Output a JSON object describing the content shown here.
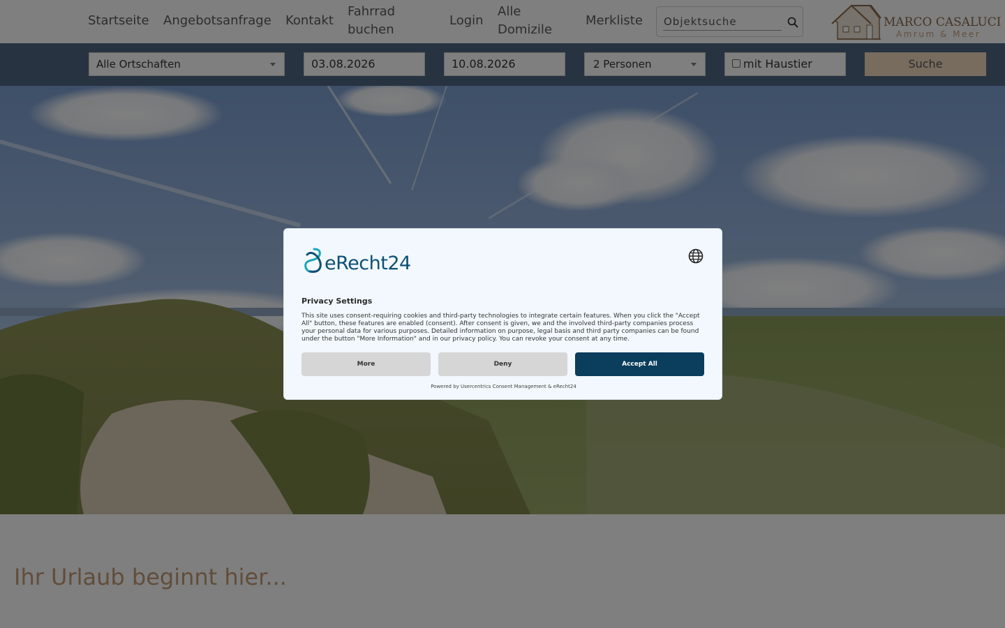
{
  "nav": {
    "items": [
      {
        "label": "Startseite"
      },
      {
        "label": "Angebotsanfrage"
      },
      {
        "label": "Kontakt"
      },
      {
        "label": "Fahrrad buchen",
        "line1": "Fahrrad",
        "line2": "buchen"
      },
      {
        "label": "Login"
      },
      {
        "label": "Alle Domizile",
        "line1": "Alle",
        "line2": "Domizile"
      },
      {
        "label": "Merkliste"
      }
    ],
    "search_placeholder": "Objektsuche",
    "search_icon": "search-icon"
  },
  "logo": {
    "name": "MARCO CASALUCI",
    "subtitle": "Amrum & Meer",
    "icon": "house-icon"
  },
  "filters": {
    "location": "Alle Ortschaften",
    "arrival": "03.08.2026",
    "departure": "10.08.2026",
    "persons": "2 Personen",
    "pet_label": "mit Haustier",
    "pet_checked": false,
    "search_button": "Suche"
  },
  "hero": {
    "tagline": "Ihr Urlaub beginnt hier..."
  },
  "consent": {
    "brand": "eRecht24",
    "language_icon": "globe-icon",
    "title": "Privacy Settings",
    "body": "This site uses consent-requiring cookies and third-party technologies to integrate certain features. When you click the \"Accept All\" button, these features are enabled (consent). After consent is given, we and the involved third-party companies process your personal data for various purposes. Detailed information on purpose, legal basis and third party companies can be found under the button \"More Information\" and in our privacy policy. You can revoke your consent at any time.",
    "buttons": {
      "more": "More",
      "deny": "Deny",
      "accept": "Accept All"
    },
    "powered_by": "Powered by Usercentrics Consent Management & eRecht24"
  },
  "colors": {
    "filterbar": "#506782",
    "accent": "#c29b74",
    "search_button": "#f1d8bf",
    "accept_button": "#0b3d5c"
  }
}
